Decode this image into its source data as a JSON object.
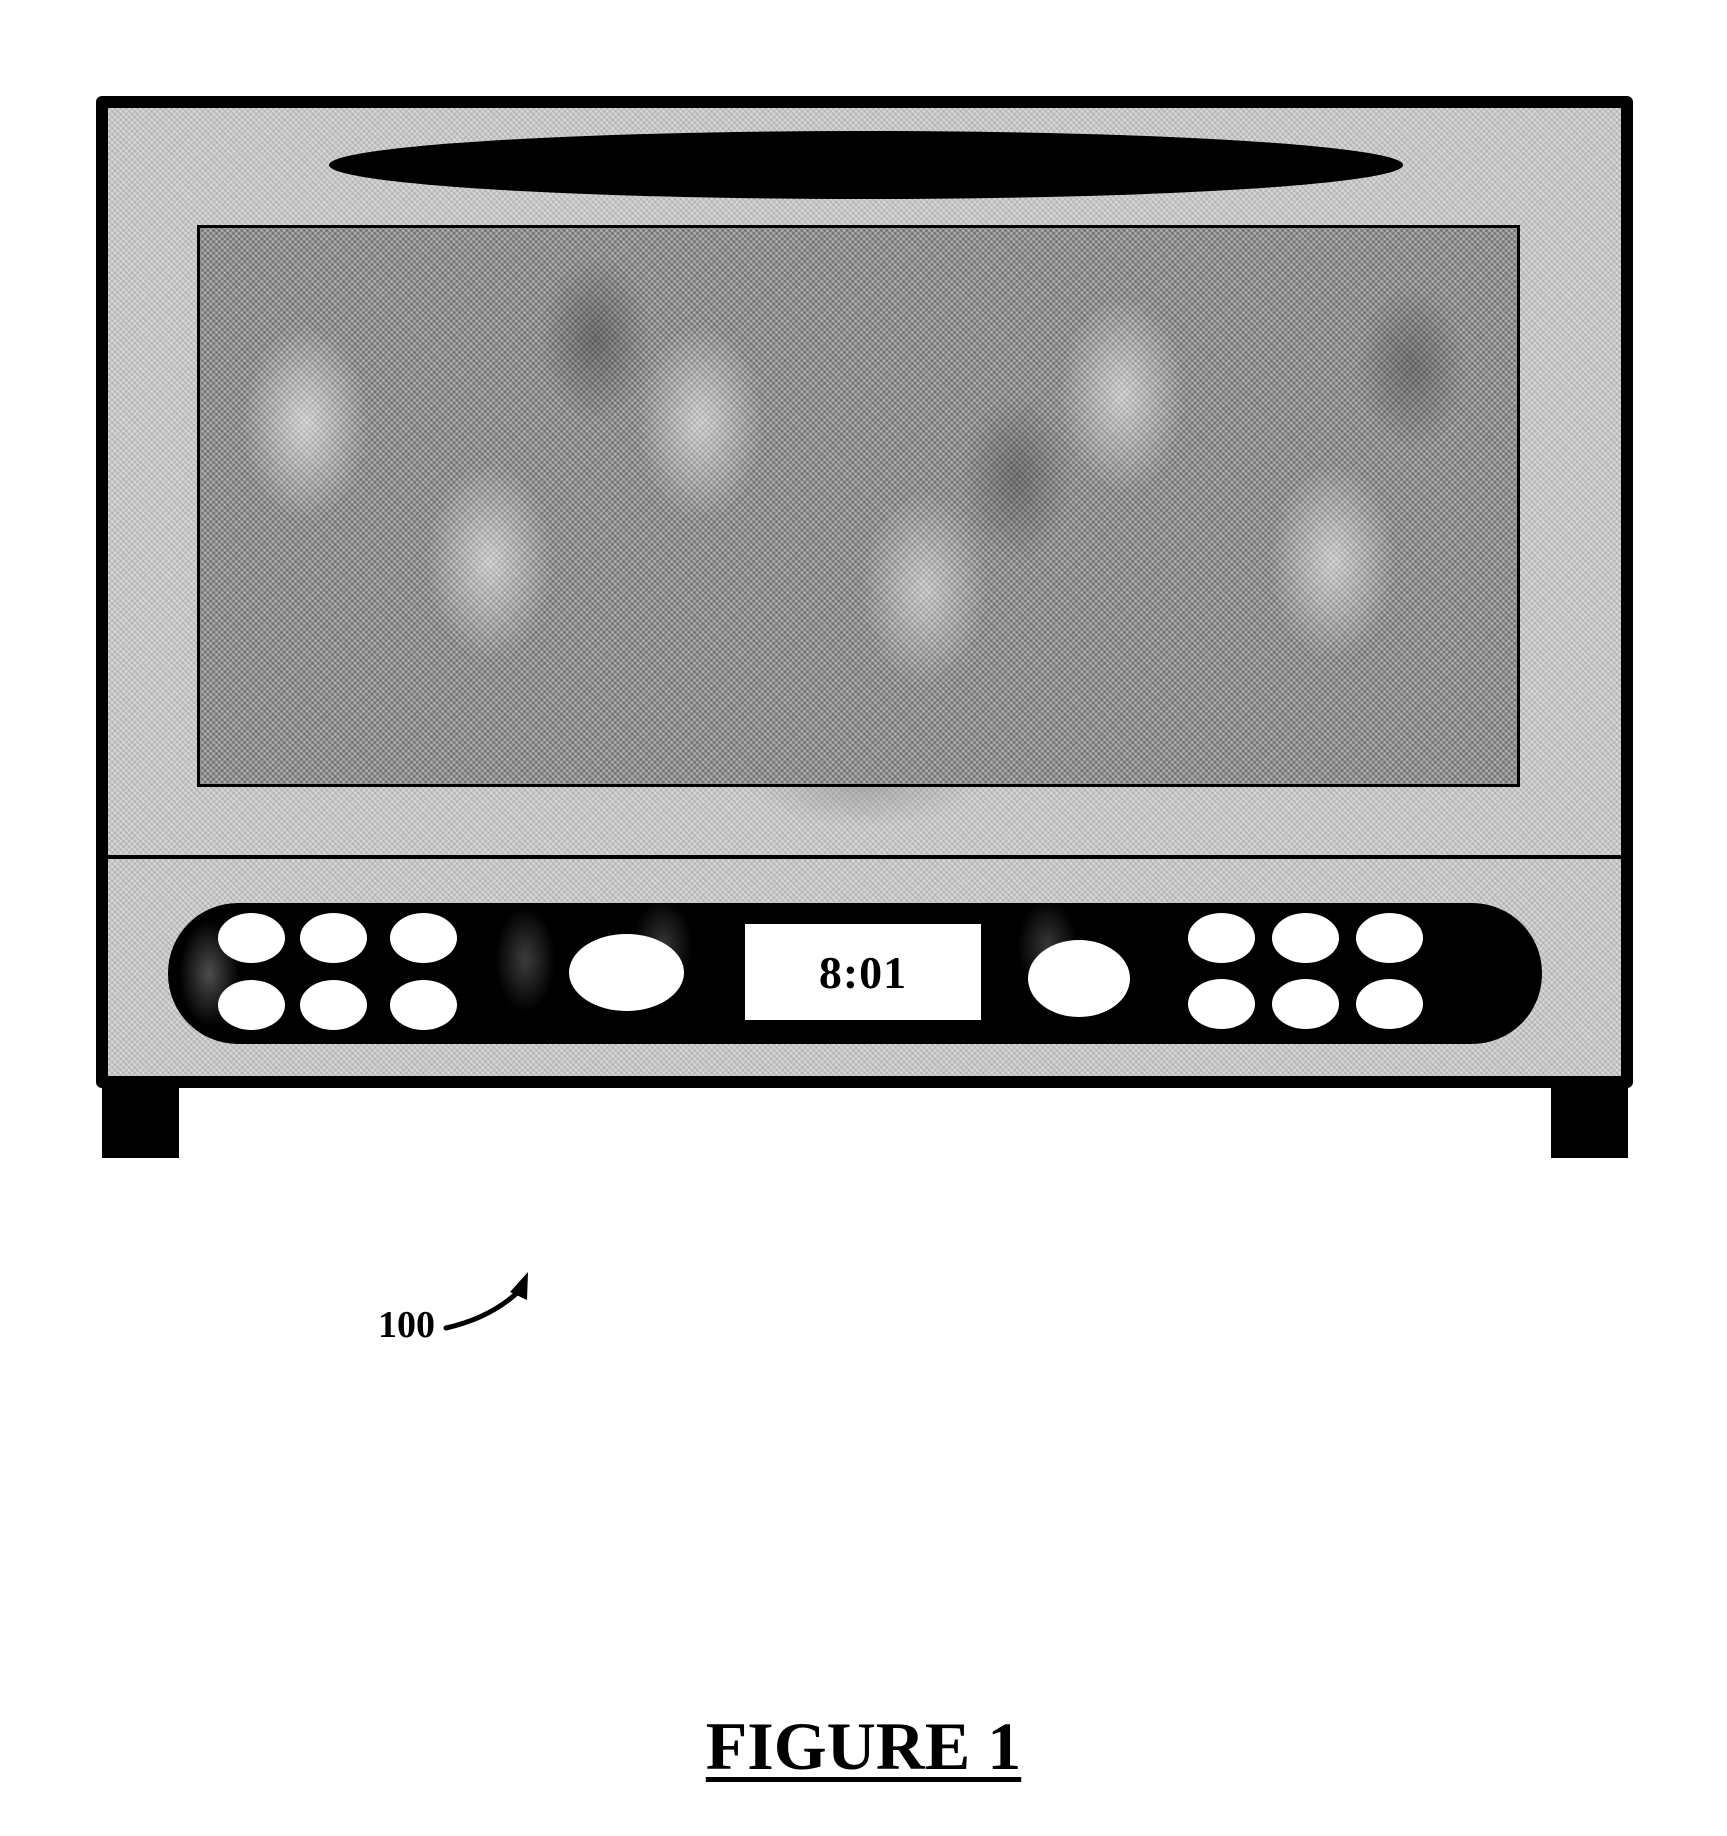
{
  "figure": {
    "caption": "FIGURE 1",
    "reference_numeral": "100",
    "reference_arrow_icon": "curved-arrow-icon"
  },
  "appliance": {
    "type": "toaster oven",
    "display": {
      "time": "8:01"
    },
    "controls": {
      "left_button_grid": {
        "rows": 2,
        "columns": 3
      },
      "left_large_button": 1,
      "right_large_button": 1,
      "right_button_grid": {
        "rows": 2,
        "columns": 3
      }
    }
  },
  "colors": {
    "outline": "#000000",
    "background": "#ffffff",
    "body_texture": "#d9d9d9",
    "window_texture": "#b3b3b3",
    "control_strip": "#000000",
    "buttons": "#ffffff"
  }
}
